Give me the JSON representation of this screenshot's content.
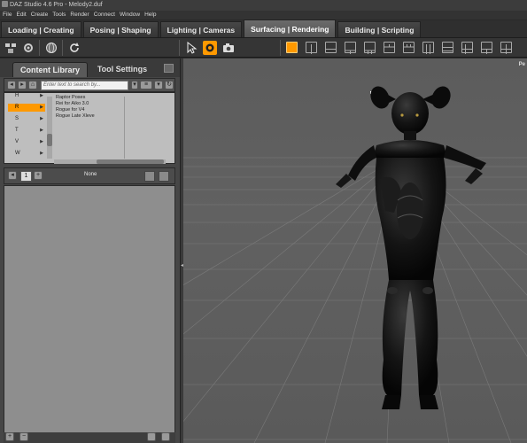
{
  "window": {
    "title": "DAZ Studio 4.6 Pro - Melody2.duf"
  },
  "menu": [
    "File",
    "Edit",
    "Create",
    "Tools",
    "Render",
    "Connect",
    "Window",
    "Help"
  ],
  "main_tabs": [
    {
      "label": "Loading | Creating",
      "active": false
    },
    {
      "label": "Posing | Shaping",
      "active": false
    },
    {
      "label": "Lighting | Cameras",
      "active": false
    },
    {
      "label": "Surfacing | Rendering",
      "active": true
    },
    {
      "label": "Building | Scripting",
      "active": false
    }
  ],
  "toolbar": {
    "icons": [
      "scene-icon",
      "settings-icon",
      "globe-icon",
      "refresh-icon",
      "pointer-icon",
      "universal-tool-icon",
      "render-camera-icon"
    ],
    "viewport_layouts": [
      "single-view",
      "two-column",
      "two-row",
      "three-left",
      "three-right",
      "three-top",
      "three-bottom",
      "four-grid"
    ],
    "active_layout": "single-view",
    "accent_color": "#ff9900"
  },
  "left_panel": {
    "tabs": {
      "content_library": "Content Library",
      "tool_settings": "Tool Settings"
    },
    "search_placeholder": "Enter text to search by...",
    "letters": [
      {
        "label": "H",
        "selected": false
      },
      {
        "label": "R",
        "selected": true
      },
      {
        "label": "S",
        "selected": false
      },
      {
        "label": "T",
        "selected": false
      },
      {
        "label": "V",
        "selected": false
      },
      {
        "label": "W",
        "selected": false
      }
    ],
    "files": [
      "Raptor Poses",
      "Rei for Aiko 3.0",
      "Rogue for V4",
      "Rogue Late Xleve"
    ],
    "page": "1",
    "filter_label": "None"
  },
  "viewport": {
    "label": "Pe",
    "figure": "black cat-eared character in black bodysuit"
  }
}
